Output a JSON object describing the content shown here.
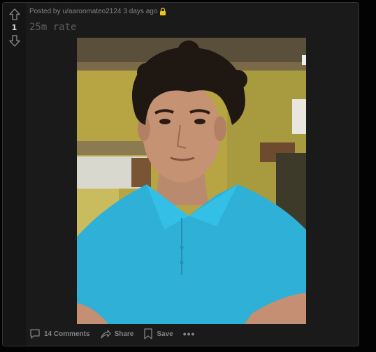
{
  "post": {
    "vote_count": "1",
    "posted_by_prefix": "Posted by",
    "author": "u/aaronmateo2124",
    "age": "3 days ago",
    "title": "25m rate",
    "icons": {
      "upvote": "arrow-up-icon",
      "downvote": "arrow-down-icon",
      "lock": "lock-icon",
      "comment": "comment-icon",
      "share": "share-icon",
      "save": "bookmark-icon",
      "more": "more-dots-icon"
    }
  },
  "actions": {
    "comments_label": "14 Comments",
    "share_label": "Share",
    "save_label": "Save",
    "more_label": "•••"
  },
  "colors": {
    "page_bg": "#030303",
    "card_bg": "#1a1a1b",
    "text_muted": "#818384",
    "lock_gold": "#f0c419",
    "shirt": "#2fb0d6"
  }
}
